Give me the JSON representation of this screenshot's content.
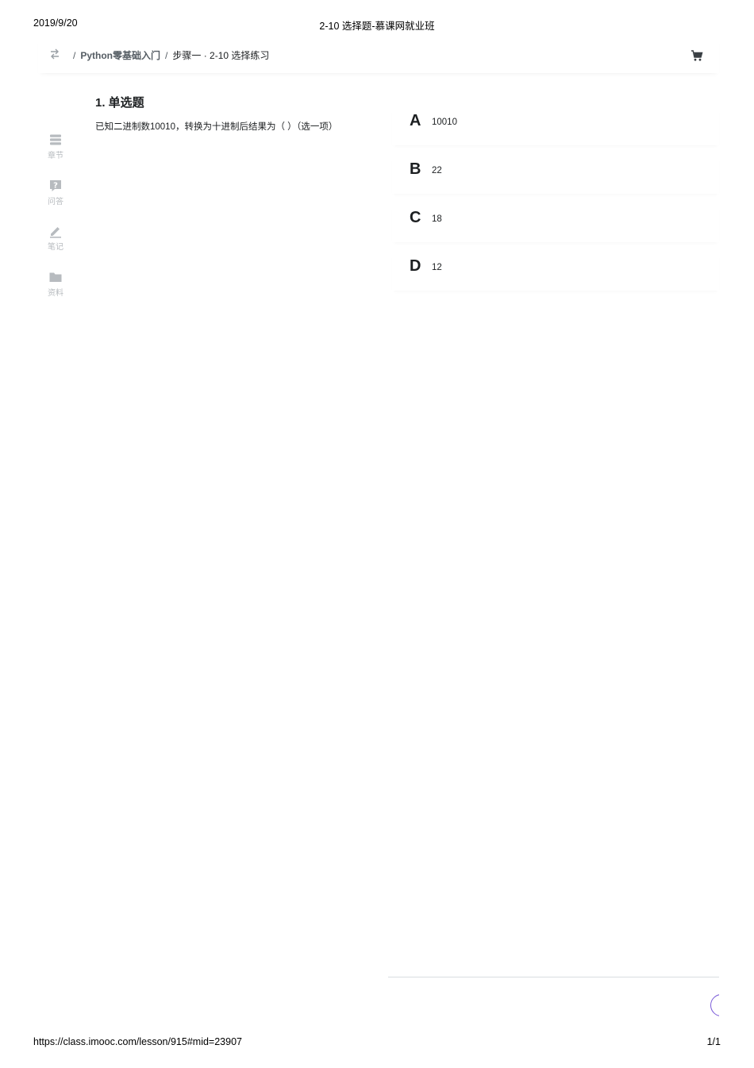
{
  "print": {
    "date": "2019/9/20",
    "doc_title": "2-10 选择题-慕课网就业班",
    "url": "https://class.imooc.com/lesson/915#mid=23907",
    "page": "1/1"
  },
  "topbar": {
    "switch_icon": "switch-arrows-icon",
    "breadcrumb": {
      "separator": "/",
      "course": "Python零基础入门",
      "lesson": "步骤一 · 2-10 选择练习"
    },
    "cart_icon": "cart-icon"
  },
  "sidebar": {
    "items": [
      {
        "label": "章节",
        "icon": "chapter-icon"
      },
      {
        "label": "问答",
        "icon": "question-icon"
      },
      {
        "label": "笔记",
        "icon": "pencil-icon"
      },
      {
        "label": "资料",
        "icon": "folder-icon"
      }
    ]
  },
  "question": {
    "title": "1. 单选题",
    "text": "已知二进制数10010，转换为十进制后结果为（ ）（选一项）"
  },
  "options": [
    {
      "letter": "A",
      "value": "10010"
    },
    {
      "letter": "B",
      "value": "22"
    },
    {
      "letter": "C",
      "value": "18"
    },
    {
      "letter": "D",
      "value": "12"
    }
  ],
  "colors": {
    "text": "#1c1f21",
    "muted": "#b7bbbf",
    "accent": "#7a5ad8"
  }
}
